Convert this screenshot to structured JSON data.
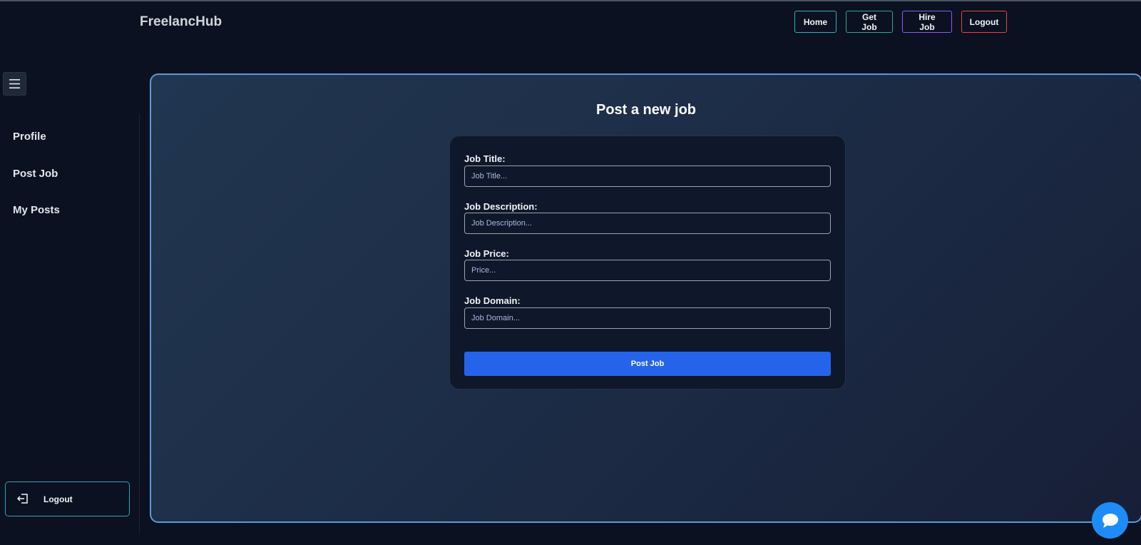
{
  "header": {
    "brand": "FreelancHub",
    "nav": {
      "home": "Home",
      "get_job": "Get Job",
      "hire_job": "Hire Job",
      "logout": "Logout"
    }
  },
  "sidebar": {
    "items": [
      "Profile",
      "Post Job",
      "My Posts"
    ],
    "logout_label": "Logout"
  },
  "main": {
    "title": "Post a new job",
    "form": {
      "fields": [
        {
          "label": "Job Title:",
          "placeholder": "Job Title...",
          "value": ""
        },
        {
          "label": "Job Description:",
          "placeholder": "Job Description...",
          "value": ""
        },
        {
          "label": "Job Price:",
          "placeholder": "Price...",
          "value": ""
        },
        {
          "label": "Job Domain:",
          "placeholder": "Job Domain...",
          "value": ""
        }
      ],
      "submit_label": "Post Job"
    }
  },
  "icons": {
    "menu": "hamburger-menu-icon",
    "logout": "logout-icon",
    "chat": "chat-bubble-icon"
  },
  "colors": {
    "accent": "#2563eb",
    "panel_border": "#5b9bd5",
    "chat": "#1d8cf8"
  }
}
